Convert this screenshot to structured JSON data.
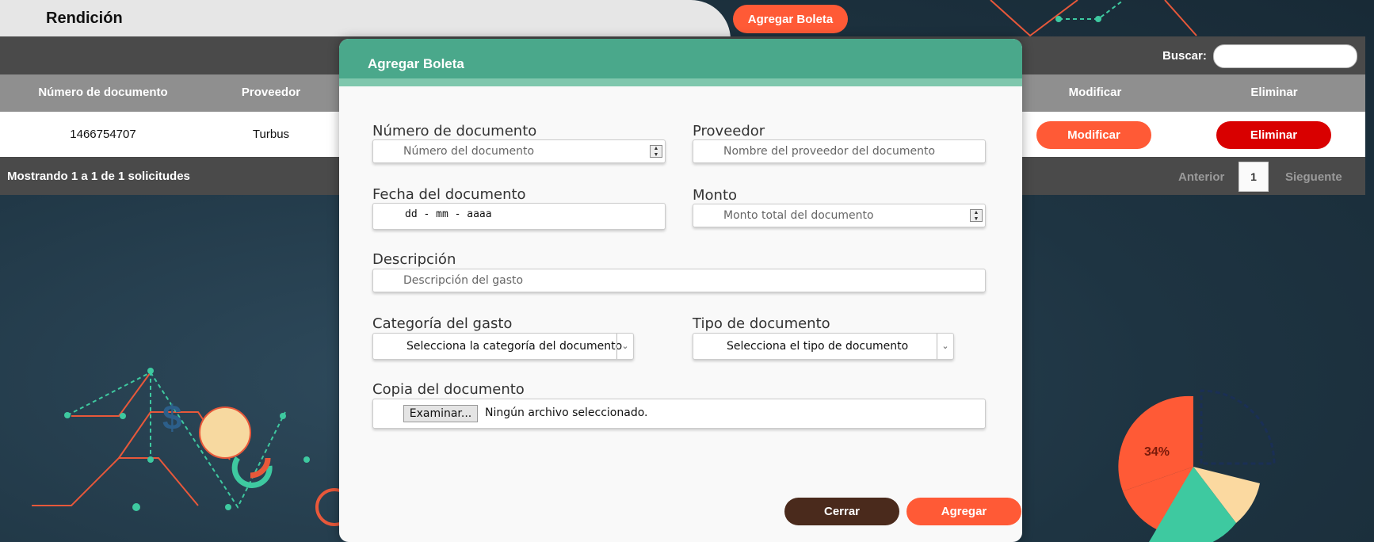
{
  "header": {
    "title": "Rendición",
    "add_button": "Agregar Boleta"
  },
  "toolbar": {
    "search_label": "Buscar:",
    "search_value": ""
  },
  "table": {
    "columns": [
      "Número de documento",
      "Proveedor",
      "Modificar",
      "Eliminar"
    ],
    "rows": [
      {
        "numero": "1466754707",
        "proveedor": "Turbus",
        "modificar_label": "Modificar",
        "eliminar_label": "Eliminar"
      }
    ]
  },
  "footer": {
    "showing": "Mostrando 1 a 1 de 1 solicitudes",
    "prev": "Anterior",
    "page": "1",
    "next": "Sieguente"
  },
  "background": {
    "percent_label": "34%"
  },
  "modal": {
    "title": "Agregar Boleta",
    "fields": {
      "numero": {
        "label": "Número de documento",
        "placeholder": "Número del documento"
      },
      "proveedor": {
        "label": "Proveedor",
        "placeholder": "Nombre del proveedor del documento"
      },
      "fecha": {
        "label": "Fecha del documento",
        "placeholder": "dd - mm - aaaa"
      },
      "monto": {
        "label": "Monto",
        "placeholder": "Monto total del documento"
      },
      "descripcion": {
        "label": "Descripción",
        "placeholder": "Descripción del gasto"
      },
      "categoria": {
        "label": "Categoría del gasto",
        "selected": "Selecciona la categoría del documento"
      },
      "tipo": {
        "label": "Tipo de documento",
        "selected": "Selecciona el tipo de documento"
      },
      "copia": {
        "label": "Copia del documento",
        "browse": "Examinar...",
        "no_file": "Ningún archivo seleccionado."
      }
    },
    "close_label": "Cerrar",
    "submit_label": "Agregar"
  },
  "colors": {
    "accent_orange": "#ff5a36",
    "danger_red": "#d90000",
    "modal_header_green": "#4aa88b",
    "close_brown": "#4a2a1c"
  }
}
